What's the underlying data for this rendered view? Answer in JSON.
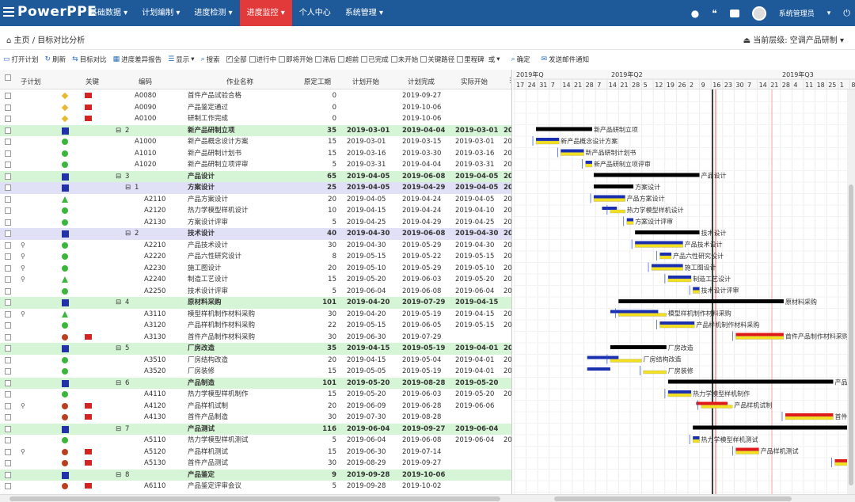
{
  "app": {
    "logo": "PowerPPE"
  },
  "topnav": [
    "基础数据",
    "计划编制",
    "进度检测",
    "进度监控",
    "个人中心",
    "系统管理"
  ],
  "user": {
    "name": "系统管理员"
  },
  "breadcrumb": {
    "home": "主页",
    "current": "目标对比分析"
  },
  "level": {
    "label": "当前层级:",
    "value": "空调产品研制"
  },
  "toolbar": {
    "items": [
      "打开计划",
      "刷新",
      "目标对比",
      "进度差异报告",
      "显示",
      "搜索"
    ],
    "filters": [
      "全部",
      "进行中",
      "即将开始",
      "滞后",
      "超前",
      "已完成",
      "未开始",
      "关键路径",
      "里程碑"
    ],
    "or": "或",
    "confirm": "确定",
    "mail": "发送邮件通知"
  },
  "grid": {
    "headers": [
      "子计划",
      "关键",
      "编码",
      "作业名称",
      "原定工期",
      "计划开始",
      "计划完成",
      "实际开始"
    ],
    "rows": [
      {
        "code": "A0080",
        "name": "首件产品试验合格",
        "dur": "0",
        "ps": "",
        "pf": "2019-09-27",
        "as": "",
        "status": "diamond",
        "key": true,
        "type": "act"
      },
      {
        "code": "A0090",
        "name": "产品鉴定通过",
        "dur": "0",
        "ps": "",
        "pf": "2019-10-06",
        "as": "",
        "status": "diamond",
        "key": true,
        "type": "act"
      },
      {
        "code": "A0100",
        "name": "研制工作完成",
        "dur": "0",
        "ps": "",
        "pf": "2019-10-06",
        "as": "",
        "status": "diamond",
        "key": true,
        "type": "act"
      },
      {
        "code": "2",
        "name": "新产品研制立项",
        "dur": "35",
        "ps": "2019-03-01",
        "pf": "2019-04-04",
        "as": "2019-03-01",
        "extra": "20",
        "status": "grp",
        "key": false,
        "type": "summ",
        "lvl": 0
      },
      {
        "code": "A1000",
        "name": "新产品概念设计方案",
        "dur": "15",
        "ps": "2019-03-01",
        "pf": "2019-03-15",
        "as": "2019-03-01",
        "extra": "20",
        "status": "green",
        "key": false,
        "type": "act"
      },
      {
        "code": "A1010",
        "name": "新产品研制计划书",
        "dur": "15",
        "ps": "2019-03-16",
        "pf": "2019-03-30",
        "as": "2019-03-16",
        "extra": "20",
        "status": "green",
        "key": false,
        "type": "act"
      },
      {
        "code": "A1020",
        "name": "新产品研制立项评审",
        "dur": "5",
        "ps": "2019-03-31",
        "pf": "2019-04-04",
        "as": "2019-03-31",
        "extra": "20",
        "status": "green",
        "key": false,
        "type": "act"
      },
      {
        "code": "3",
        "name": "产品设计",
        "dur": "65",
        "ps": "2019-04-05",
        "pf": "2019-06-08",
        "as": "2019-04-05",
        "extra": "20",
        "status": "grp",
        "key": false,
        "type": "summ",
        "lvl": 0
      },
      {
        "code": "1",
        "name": "方案设计",
        "dur": "25",
        "ps": "2019-04-05",
        "pf": "2019-04-29",
        "as": "2019-04-05",
        "extra": "20",
        "status": "grp",
        "key": false,
        "type": "sub",
        "lvl": 1
      },
      {
        "code": "A2110",
        "name": "产品方案设计",
        "dur": "20",
        "ps": "2019-04-05",
        "pf": "2019-04-24",
        "as": "2019-04-05",
        "extra": "20",
        "status": "tri",
        "key": false,
        "type": "act"
      },
      {
        "code": "A2120",
        "name": "热力学模型样机设计",
        "dur": "10",
        "ps": "2019-04-15",
        "pf": "2019-04-24",
        "as": "2019-04-10",
        "extra": "20",
        "status": "green",
        "key": false,
        "type": "act"
      },
      {
        "code": "A2130",
        "name": "方案设计评审",
        "dur": "5",
        "ps": "2019-04-25",
        "pf": "2019-04-29",
        "as": "2019-04-25",
        "extra": "20",
        "status": "green",
        "key": false,
        "type": "act"
      },
      {
        "code": "2",
        "name": "技术设计",
        "dur": "40",
        "ps": "2019-04-30",
        "pf": "2019-06-08",
        "as": "2019-04-30",
        "extra": "20",
        "status": "grp",
        "key": false,
        "type": "sub",
        "lvl": 1
      },
      {
        "code": "A2210",
        "name": "产品技术设计",
        "dur": "30",
        "ps": "2019-04-30",
        "pf": "2019-05-29",
        "as": "2019-04-30",
        "extra": "20",
        "status": "green",
        "key": false,
        "type": "act",
        "link": true
      },
      {
        "code": "A2220",
        "name": "产品六性研究设计",
        "dur": "8",
        "ps": "2019-05-15",
        "pf": "2019-05-22",
        "as": "2019-05-15",
        "extra": "20",
        "status": "green",
        "key": false,
        "type": "act",
        "link": true
      },
      {
        "code": "A2230",
        "name": "施工图设计",
        "dur": "20",
        "ps": "2019-05-10",
        "pf": "2019-05-29",
        "as": "2019-05-10",
        "extra": "20",
        "status": "green",
        "key": false,
        "type": "act",
        "link": true
      },
      {
        "code": "A2240",
        "name": "制造工艺设计",
        "dur": "15",
        "ps": "2019-05-20",
        "pf": "2019-06-03",
        "as": "2019-05-20",
        "extra": "20",
        "status": "tri",
        "key": false,
        "type": "act",
        "link": true
      },
      {
        "code": "A2250",
        "name": "技术设计评审",
        "dur": "5",
        "ps": "2019-06-04",
        "pf": "2019-06-08",
        "as": "2019-06-04",
        "extra": "20",
        "status": "green",
        "key": false,
        "type": "act"
      },
      {
        "code": "4",
        "name": "原材料采购",
        "dur": "101",
        "ps": "2019-04-20",
        "pf": "2019-07-29",
        "as": "2019-04-15",
        "extra": "",
        "status": "grp",
        "key": false,
        "type": "summ",
        "lvl": 0
      },
      {
        "code": "A3110",
        "name": "模型样机制作材料采购",
        "dur": "30",
        "ps": "2019-04-20",
        "pf": "2019-05-19",
        "as": "2019-04-15",
        "extra": "20",
        "status": "tri",
        "key": false,
        "type": "act",
        "link": true
      },
      {
        "code": "A3120",
        "name": "产品样机制作材料采购",
        "dur": "22",
        "ps": "2019-05-15",
        "pf": "2019-06-05",
        "as": "2019-05-15",
        "extra": "20",
        "status": "green",
        "key": false,
        "type": "act"
      },
      {
        "code": "A3130",
        "name": "首件产品制作材料采购",
        "dur": "30",
        "ps": "2019-06-30",
        "pf": "2019-07-29",
        "as": "",
        "extra": "",
        "status": "red",
        "key": true,
        "type": "act"
      },
      {
        "code": "5",
        "name": "厂房改造",
        "dur": "35",
        "ps": "2019-04-15",
        "pf": "2019-05-19",
        "as": "2019-04-01",
        "extra": "20",
        "status": "grp",
        "key": false,
        "type": "summ",
        "lvl": 0
      },
      {
        "code": "A3510",
        "name": "厂房结构改造",
        "dur": "20",
        "ps": "2019-04-15",
        "pf": "2019-05-04",
        "as": "2019-04-01",
        "extra": "20",
        "status": "green",
        "key": false,
        "type": "act"
      },
      {
        "code": "A3520",
        "name": "厂房装修",
        "dur": "15",
        "ps": "2019-05-05",
        "pf": "2019-05-19",
        "as": "2019-04-01",
        "extra": "20",
        "status": "green",
        "key": false,
        "type": "act"
      },
      {
        "code": "6",
        "name": "产品制造",
        "dur": "101",
        "ps": "2019-05-20",
        "pf": "2019-08-28",
        "as": "2019-05-20",
        "extra": "",
        "status": "grp",
        "key": false,
        "type": "summ",
        "lvl": 0
      },
      {
        "code": "A4110",
        "name": "热力学模型样机制作",
        "dur": "15",
        "ps": "2019-05-20",
        "pf": "2019-06-03",
        "as": "2019-05-20",
        "extra": "20",
        "status": "green",
        "key": false,
        "type": "act"
      },
      {
        "code": "A4120",
        "name": "产品样机试制",
        "dur": "20",
        "ps": "2019-06-09",
        "pf": "2019-06-28",
        "as": "2019-06-06",
        "extra": "",
        "status": "red",
        "key": true,
        "type": "act",
        "link": true
      },
      {
        "code": "A4130",
        "name": "首件产品制造",
        "dur": "30",
        "ps": "2019-07-30",
        "pf": "2019-08-28",
        "as": "",
        "extra": "",
        "status": "red",
        "key": true,
        "type": "act"
      },
      {
        "code": "7",
        "name": "产品测试",
        "dur": "116",
        "ps": "2019-06-04",
        "pf": "2019-09-27",
        "as": "2019-06-04",
        "extra": "",
        "status": "grp",
        "key": false,
        "type": "summ",
        "lvl": 0
      },
      {
        "code": "A5110",
        "name": "热力学模型样机测试",
        "dur": "5",
        "ps": "2019-06-04",
        "pf": "2019-06-08",
        "as": "2019-06-04",
        "extra": "20",
        "status": "green",
        "key": false,
        "type": "act"
      },
      {
        "code": "A5120",
        "name": "产品样机测试",
        "dur": "15",
        "ps": "2019-06-30",
        "pf": "2019-07-14",
        "as": "",
        "extra": "",
        "status": "red",
        "key": true,
        "type": "act",
        "link": true
      },
      {
        "code": "A5130",
        "name": "首件产品测试",
        "dur": "30",
        "ps": "2019-08-29",
        "pf": "2019-09-27",
        "as": "",
        "extra": "",
        "status": "red",
        "key": true,
        "type": "act"
      },
      {
        "code": "8",
        "name": "产品鉴定",
        "dur": "9",
        "ps": "2019-09-28",
        "pf": "2019-10-06",
        "as": "",
        "extra": "",
        "status": "grp",
        "key": false,
        "type": "summ",
        "lvl": 0
      },
      {
        "code": "A6110",
        "name": "产品鉴定评审会议",
        "dur": "5",
        "ps": "2019-09-28",
        "pf": "2019-10-02",
        "as": "",
        "extra": "",
        "status": "red",
        "key": true,
        "type": "act"
      }
    ]
  },
  "gantt": {
    "quarters": [
      "2019年Q",
      "2019年Q2",
      "2019年Q3"
    ],
    "days": [
      "17",
      "24",
      "31",
      "7",
      "14",
      "21",
      "28",
      "7",
      "14",
      "21",
      "28",
      "5",
      "12",
      "19",
      "26",
      "2",
      "9",
      "16",
      "23",
      "30",
      "7",
      "14",
      "21",
      "28",
      "4",
      "11",
      "18",
      "25",
      "1",
      "8"
    ],
    "labels": [
      "新产品研制立项",
      "新产品概念设计方案",
      "新产品研制计划书",
      "新产品研制立项评审",
      "产品设计",
      "方案设计",
      "产品方案设计",
      "热力学模型样机设计",
      "方案设计评审",
      "技术设计",
      "产品技术设计",
      "产品六性研究设计",
      "施工图设计",
      "制造工艺设计",
      "技术设计评审",
      "原材料采购",
      "模型样机制作材料采购",
      "产品样机制作材料采购",
      "首件产品制作材料采购",
      "厂房改造",
      "厂房结构改造",
      "厂房装修",
      "产品制造",
      "热力学模型样机制作",
      "产品样机试制",
      "首件产品制造",
      "产品测试",
      "热力学模型样机测试",
      "产品样机测试",
      "首件产品测试"
    ]
  }
}
